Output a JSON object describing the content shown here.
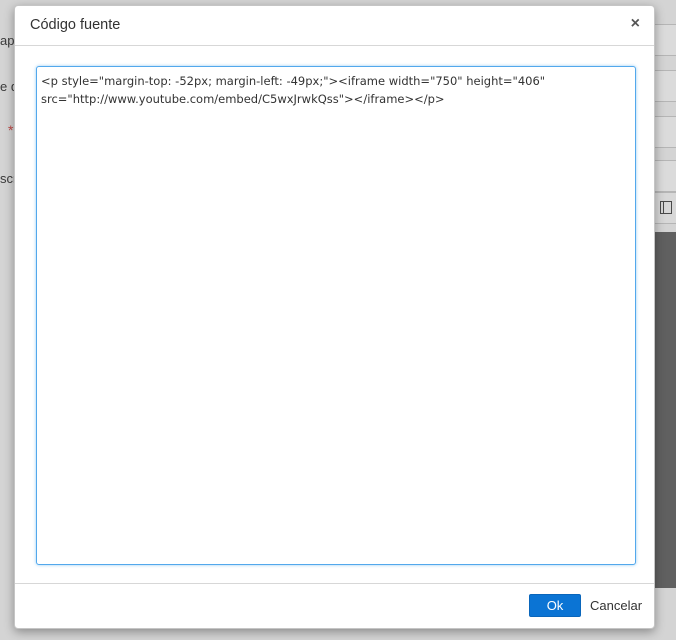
{
  "background": {
    "labels": [
      "ap",
      "e d",
      "scr"
    ],
    "required_marker": "*"
  },
  "dialog": {
    "title": "Código fuente",
    "close_glyph": "×",
    "source_code": "<p style=\"margin-top: -52px; margin-left: -49px;\"><iframe width=\"750\" height=\"406\" src=\"http://www.youtube.com/embed/C5wxJrwkQss\"></iframe></p>",
    "ok_label": "Ok",
    "cancel_label": "Cancelar"
  },
  "colors": {
    "primary_button": "#0b74d4",
    "textarea_focus_border": "#52a8ec"
  }
}
